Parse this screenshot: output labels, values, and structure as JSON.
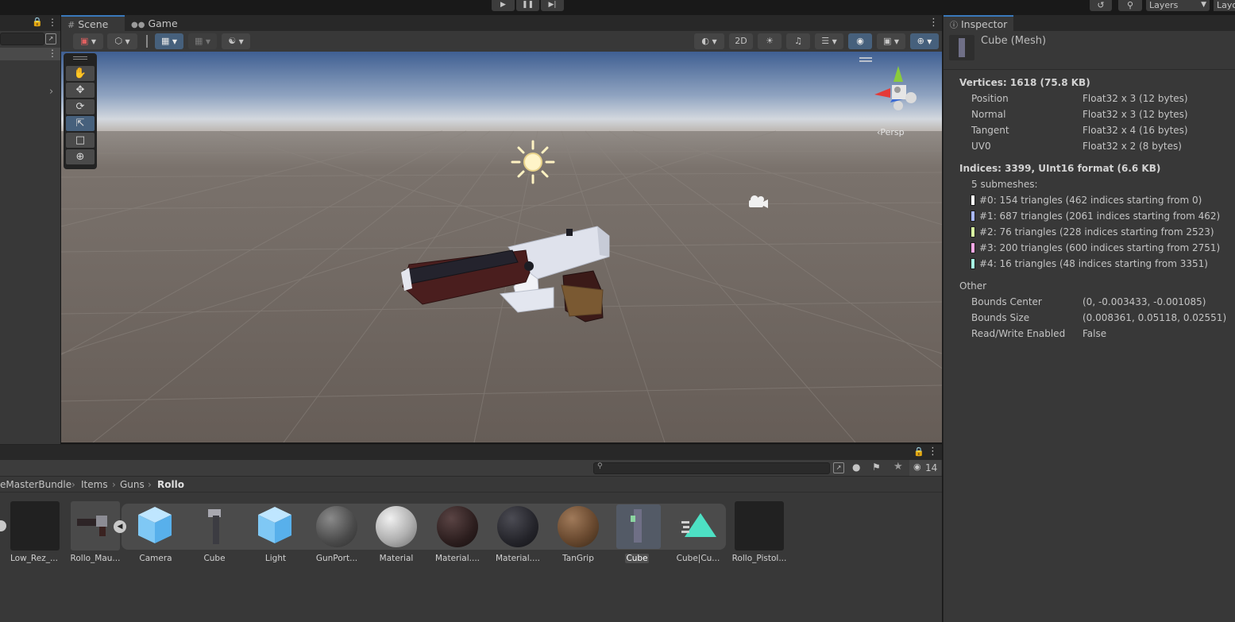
{
  "top_bar": {
    "play_icon": "play-icon",
    "pause_icon": "pause-icon",
    "step_icon": "step-icon",
    "history_icon": "history-icon",
    "search_icon": "search-icon",
    "layers_label": "Layers",
    "layout_label": "Layo"
  },
  "scene_view": {
    "tabs": [
      {
        "label": "Scene",
        "icon": "hash-icon"
      },
      {
        "label": "Game",
        "icon": "gamepad-icon"
      }
    ],
    "toolbar": {
      "twod_label": "2D"
    },
    "persp_label": "‹Persp",
    "tools": [
      "hand-tool-icon",
      "move-tool-icon",
      "rotate-tool-icon",
      "scale-tool-icon",
      "rect-tool-icon",
      "transform-tool-icon"
    ]
  },
  "inspector": {
    "tab_label": "Inspector",
    "title": "Cube (Mesh)",
    "vertices_header": "Vertices: 1618 (75.8 KB)",
    "attributes": [
      {
        "name": "Position",
        "format": "Float32 x 3 (12 bytes)"
      },
      {
        "name": "Normal",
        "format": "Float32 x 3 (12 bytes)"
      },
      {
        "name": "Tangent",
        "format": "Float32 x 4 (16 bytes)"
      },
      {
        "name": "UV0",
        "format": "Float32 x 2 (8 bytes)"
      }
    ],
    "indices_header": "Indices: 3399, UInt16 format (6.6 KB)",
    "submesh_count": "5 submeshes:",
    "submeshes": [
      {
        "text": "#0: 154 triangles (462 indices starting from 0)",
        "color": "#ffffff"
      },
      {
        "text": "#1: 687 triangles (2061 indices starting from 462)",
        "color": "#a9b8ff"
      },
      {
        "text": "#2: 76 triangles (228 indices starting from 2523)",
        "color": "#d8f5a2"
      },
      {
        "text": "#3: 200 triangles (600 indices starting from 2751)",
        "color": "#f7a8e6"
      },
      {
        "text": "#4: 16 triangles (48 indices starting from 3351)",
        "color": "#a6f5e4"
      }
    ],
    "other_header": "Other",
    "other": [
      {
        "name": "Bounds Center",
        "value": "(0, -0.003433, -0.001085)"
      },
      {
        "name": "Bounds Size",
        "value": "(0.008361, 0.05118, 0.02551)"
      },
      {
        "name": "Read/Write Enabled",
        "value": "False"
      }
    ]
  },
  "project": {
    "hidden_count": "14",
    "breadcrumb": [
      "eMasterBundle",
      "Items",
      "Guns",
      "Rollo"
    ],
    "assets": [
      {
        "label": "Low_Rez_...",
        "icon": "dark-thumbnail"
      },
      {
        "label": "Rollo_Mau...",
        "icon": "pistol-thumbnail"
      },
      {
        "label": "Camera",
        "icon": "prefab-cube-icon"
      },
      {
        "label": "Cube",
        "icon": "pistol-mesh-thumbnail"
      },
      {
        "label": "Light",
        "icon": "prefab-cube-icon"
      },
      {
        "label": "GunPort...",
        "icon": "material-sphere"
      },
      {
        "label": "Material",
        "icon": "material-sphere"
      },
      {
        "label": "Material....",
        "icon": "material-sphere"
      },
      {
        "label": "Material....",
        "icon": "material-sphere"
      },
      {
        "label": "TanGrip",
        "icon": "material-sphere"
      },
      {
        "label": "Cube",
        "icon": "mesh-thumbnail"
      },
      {
        "label": "Cube|Cu...",
        "icon": "animation-clip-icon"
      },
      {
        "label": "Rollo_Pistol...",
        "icon": "dark-thumbnail"
      }
    ]
  },
  "colors": {
    "accent": "#3a79bb",
    "panel": "#383838",
    "background": "#191919"
  }
}
